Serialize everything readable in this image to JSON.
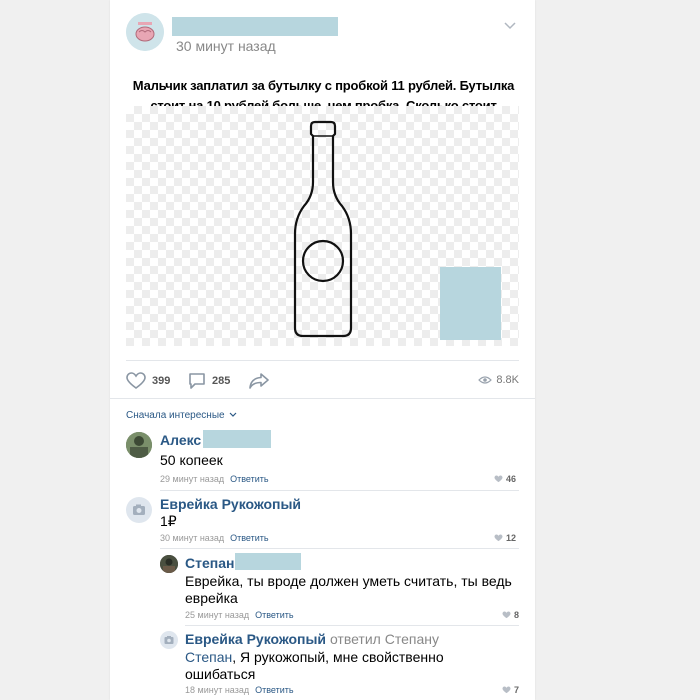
{
  "post": {
    "timestamp": "30 минут назад",
    "question": "Мальчик заплатил за бутылку с пробкой 11 рублей. Бутылка стоит на 10 рублей больше, чем пробка. Сколько стоит пробка?"
  },
  "actions": {
    "likes": "399",
    "comments": "285",
    "views": "8.8K"
  },
  "comments_section": {
    "sort_label": "Сначала интересные",
    "reply_label": "Ответить",
    "items": [
      {
        "name": "Алекс",
        "text": "50 копеек",
        "time": "29 минут назад",
        "likes": "46"
      },
      {
        "name": "Еврейка Рукожопый",
        "text": "1₽",
        "time": "30 минут назад",
        "likes": "12"
      },
      {
        "name": "Степан",
        "text": "Еврейка, ты вроде должен уметь считать, ты ведь еврейка",
        "time": "25 минут назад",
        "likes": "8"
      },
      {
        "name": "Еврейка Рукожопый",
        "replied_to": "ответил Степану",
        "mention": "Степан",
        "text": ", Я рукожопый, мне свойственно ошибаться",
        "time": "18 минут назад",
        "likes": "7"
      }
    ]
  },
  "colors": {
    "link": "#2a5885",
    "redaction": "#b7d6de"
  }
}
